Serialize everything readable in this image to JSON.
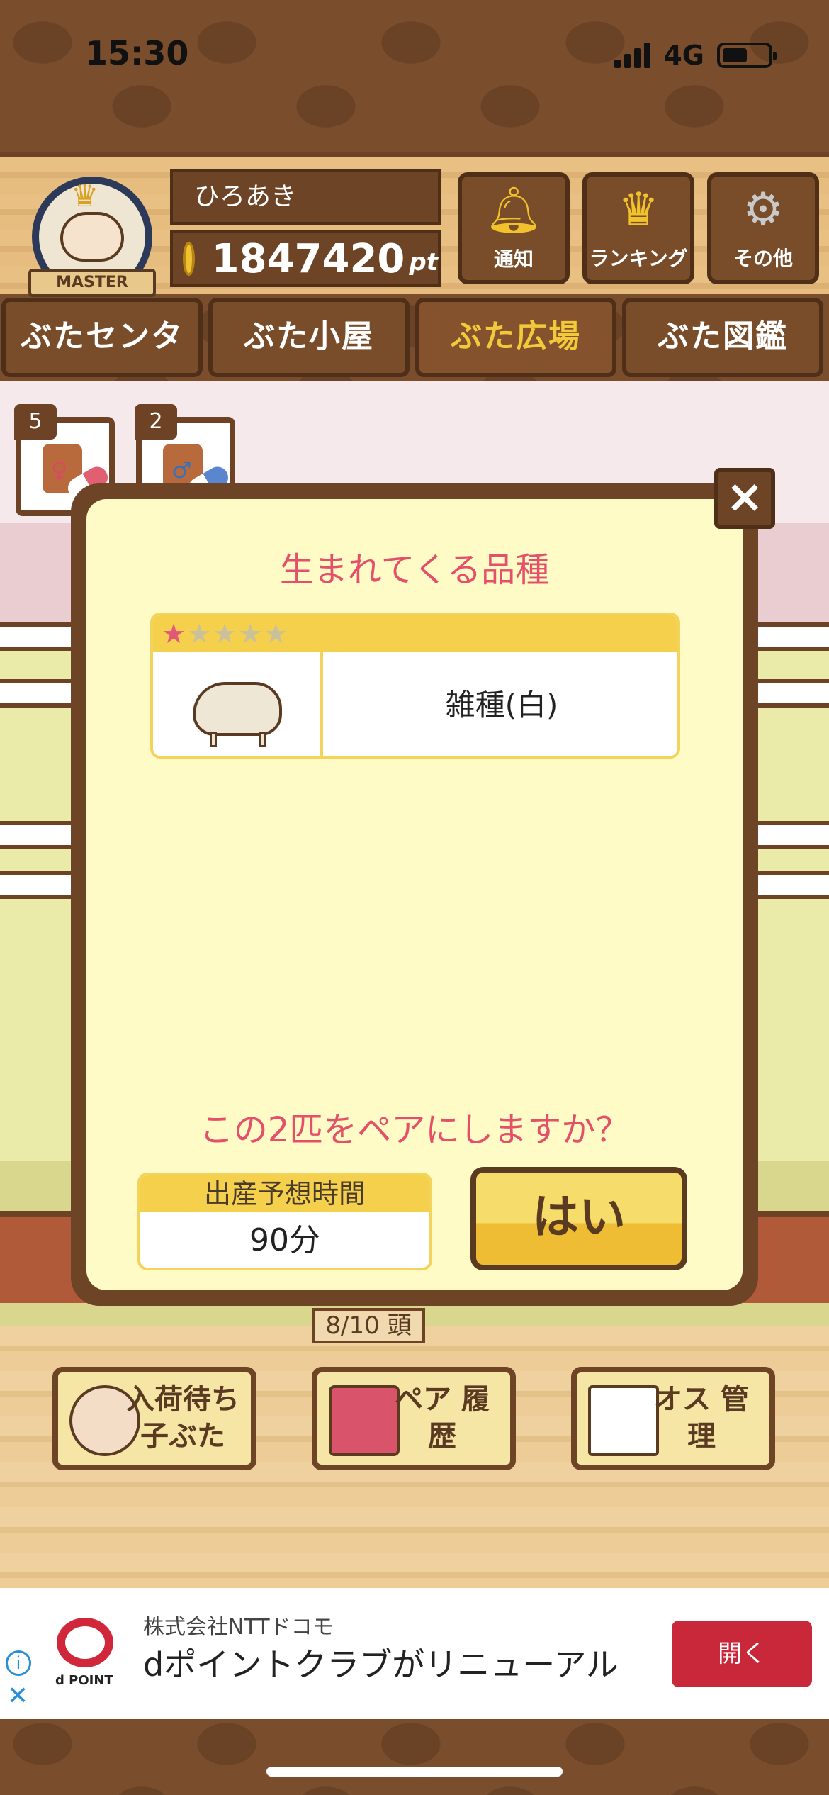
{
  "status": {
    "time": "15:30",
    "network": "4G"
  },
  "header": {
    "badge_label": "MASTER",
    "user_name": "ひろあき",
    "points": "1847420",
    "points_unit": "pt",
    "buttons": {
      "notice": "通知",
      "ranking": "ランキング",
      "other": "その他"
    }
  },
  "tabs": [
    "ぶたセンター",
    "ぶた小屋",
    "ぶた広場",
    "ぶた図鑑"
  ],
  "active_tab": "ぶた広場",
  "items": {
    "female_count": "5",
    "male_count": "2"
  },
  "modal": {
    "title": "生まれてくる品種",
    "breed": {
      "stars": 1,
      "max_stars": 5,
      "name": "雑種(白)"
    },
    "question": "この2匹をペアにしますか？",
    "time_label": "出産予想時間",
    "time_value": "90分",
    "yes_label": "はい",
    "close_label": "×"
  },
  "pen_count": "8/10 頭",
  "bottom_buttons": {
    "waiting": "入荷待ち 子ぶた",
    "pair_history": "ペア 履歴",
    "male_manage": "オス 管理"
  },
  "ad": {
    "logo_text": "d POINT",
    "sponsor": "株式会社NTTドコモ",
    "headline": "dポイントクラブがリニューアル",
    "cta": "開く"
  },
  "colors": {
    "accent_pink": "#e4506a",
    "brown": "#6e4426",
    "yellow": "#f4d04c",
    "ad_red": "#c8283a"
  }
}
